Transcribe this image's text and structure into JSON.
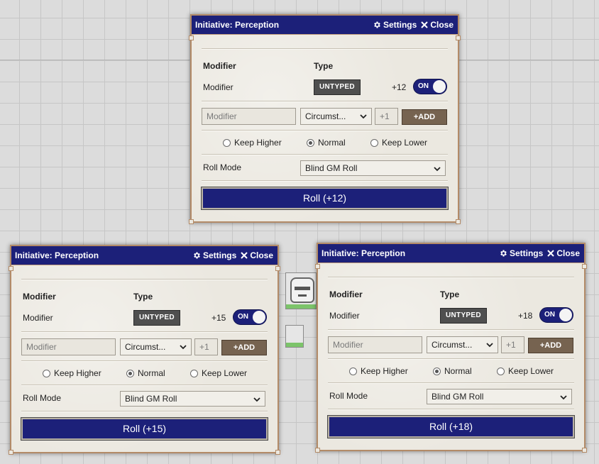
{
  "dialogs": [
    {
      "title": "Initiative: Perception",
      "settings_label": "Settings",
      "close_label": "Close",
      "modifier_header": "Modifier",
      "type_header": "Type",
      "modifier_name": "Modifier",
      "modifier_type": "UNTYPED",
      "modifier_value": "+12",
      "toggle_label": "ON",
      "new_modifier_placeholder": "Modifier",
      "new_modifier_type": "Circumst...",
      "new_modifier_value": "+1",
      "add_label": "+ADD",
      "keep_higher_label": "Keep Higher",
      "normal_label": "Normal",
      "keep_lower_label": "Keep Lower",
      "roll_mode_label": "Roll Mode",
      "roll_mode_value": "Blind GM Roll",
      "roll_button": "Roll (+12)"
    },
    {
      "title": "Initiative: Perception",
      "settings_label": "Settings",
      "close_label": "Close",
      "modifier_header": "Modifier",
      "type_header": "Type",
      "modifier_name": "Modifier",
      "modifier_type": "UNTYPED",
      "modifier_value": "+15",
      "toggle_label": "ON",
      "new_modifier_placeholder": "Modifier",
      "new_modifier_type": "Circumst...",
      "new_modifier_value": "+1",
      "add_label": "+ADD",
      "keep_higher_label": "Keep Higher",
      "normal_label": "Normal",
      "keep_lower_label": "Keep Lower",
      "roll_mode_label": "Roll Mode",
      "roll_mode_value": "Blind GM Roll",
      "roll_button": "Roll (+15)"
    },
    {
      "title": "Initiative: Perception",
      "settings_label": "Settings",
      "close_label": "Close",
      "modifier_header": "Modifier",
      "type_header": "Type",
      "modifier_name": "Modifier",
      "modifier_type": "UNTYPED",
      "modifier_value": "+18",
      "toggle_label": "ON",
      "new_modifier_placeholder": "Modifier",
      "new_modifier_type": "Circumst...",
      "new_modifier_value": "+1",
      "add_label": "+ADD",
      "keep_higher_label": "Keep Higher",
      "normal_label": "Normal",
      "keep_lower_label": "Keep Lower",
      "roll_mode_label": "Roll Mode",
      "roll_mode_value": "Blind GM Roll",
      "roll_button": "Roll (+18)"
    }
  ],
  "colors": {
    "titlebar": "#1c2079",
    "border": "#b38b68",
    "add_button": "#766350",
    "badge": "#4f4f4f"
  },
  "icons": [
    "gear-icon",
    "close-icon",
    "chevron-down-icon"
  ]
}
